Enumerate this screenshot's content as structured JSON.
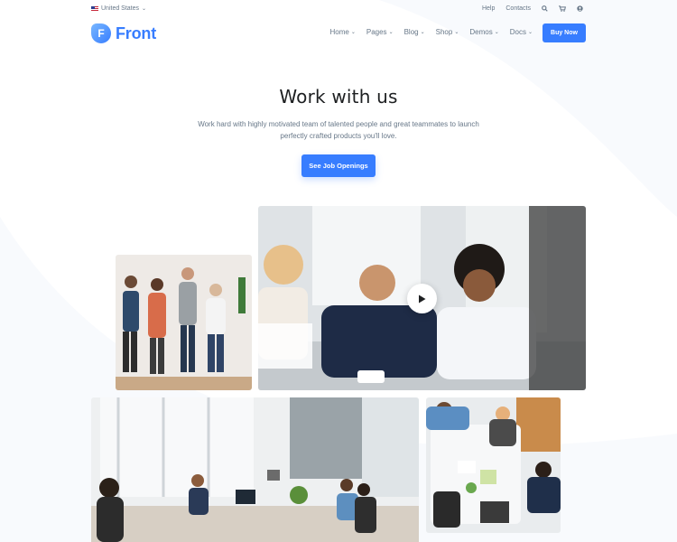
{
  "topbar": {
    "region": "United States",
    "links": [
      "Help",
      "Contacts"
    ],
    "icons": [
      "search-icon",
      "cart-icon",
      "user-icon"
    ]
  },
  "navbar": {
    "logo_mark": "F",
    "logo_text": "Front",
    "menu": [
      {
        "label": "Home"
      },
      {
        "label": "Pages"
      },
      {
        "label": "Blog"
      },
      {
        "label": "Shop"
      },
      {
        "label": "Demos"
      },
      {
        "label": "Docs"
      }
    ],
    "cta": "Buy Now"
  },
  "hero": {
    "title": "Work with us",
    "subtitle": "Work hard with highly motivated team of talented people and great teammates to launch perfectly crafted products you'll love.",
    "button": "See Job Openings"
  },
  "colors": {
    "primary": "#377dff",
    "text": "#1e2022",
    "muted": "#677788"
  },
  "icons": {
    "play": "play-icon",
    "chevron": "chevron-down-icon"
  }
}
